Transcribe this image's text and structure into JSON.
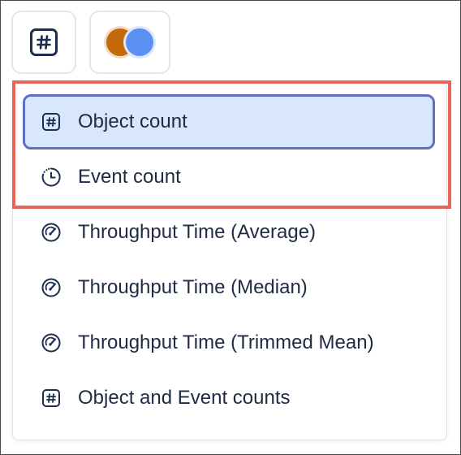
{
  "toolbar": {
    "count_button_icon": "hash-square-icon",
    "color_button_icons": [
      "orange-dot-icon",
      "blue-dot-icon"
    ],
    "colors": {
      "orange": "#c46a09",
      "blue": "#5b8ff2"
    }
  },
  "menu": {
    "items": [
      {
        "label": "Object count",
        "icon": "hash-square-icon",
        "selected": true
      },
      {
        "label": "Event count",
        "icon": "clock-icon",
        "selected": false
      },
      {
        "label": "Throughput Time (Average)",
        "icon": "gauge-icon",
        "selected": false
      },
      {
        "label": "Throughput Time (Median)",
        "icon": "gauge-icon",
        "selected": false
      },
      {
        "label": "Throughput Time (Trimmed Mean)",
        "icon": "gauge-icon",
        "selected": false
      },
      {
        "label": "Object and Event counts",
        "icon": "hash-square-icon",
        "selected": false
      }
    ],
    "selected_fill": "#d9e7fd",
    "selected_border": "#5c6fc4",
    "highlight_color": "#ec6358"
  }
}
